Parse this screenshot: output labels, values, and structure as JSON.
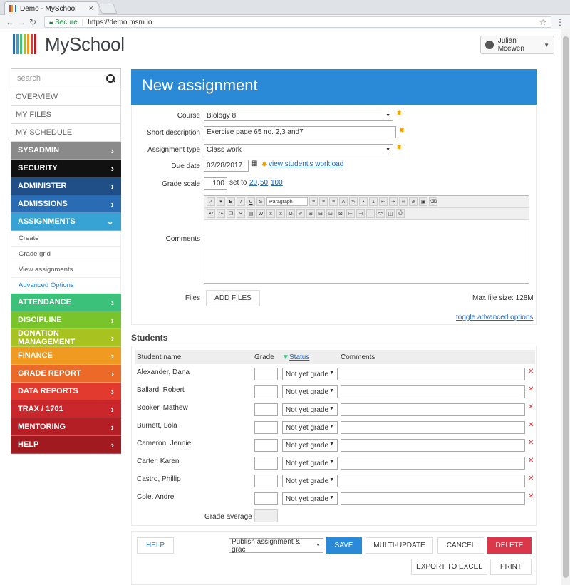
{
  "browser": {
    "tab_title": "Demo - MySchool",
    "tab_close": "×",
    "secure_label": "Secure",
    "url": "https://demo.msm.io"
  },
  "app": {
    "name": "MySchool",
    "user_name": "Julian Mcewen"
  },
  "sidebar": {
    "search_placeholder": "search",
    "plain_items": [
      "OVERVIEW",
      "MY FILES",
      "MY SCHEDULE"
    ],
    "nav": [
      {
        "label": "SYSADMIN",
        "color": "#8a8a8a"
      },
      {
        "label": "SECURITY",
        "color": "#111111"
      },
      {
        "label": "ADMINISTER",
        "color": "#1f4f86"
      },
      {
        "label": "ADMISSIONS",
        "color": "#2a6cb3"
      },
      {
        "label": "ASSIGNMENTS",
        "color": "#36a3d4"
      }
    ],
    "sub": [
      "Create",
      "Grade grid",
      "View assignments",
      "Advanced Options"
    ],
    "nav2": [
      {
        "label": "ATTENDANCE",
        "color": "#3cc17a"
      },
      {
        "label": "DISCIPLINE",
        "color": "#7ac42b"
      },
      {
        "label": "DONATION MANAGEMENT",
        "color": "#a8c21f"
      },
      {
        "label": "FINANCE",
        "color": "#f09a22"
      },
      {
        "label": "GRADE REPORT",
        "color": "#ec6a27"
      },
      {
        "label": "DATA REPORTS",
        "color": "#e23a2e"
      },
      {
        "label": "TRAX / 1701",
        "color": "#c9272c"
      },
      {
        "label": "MENTORING",
        "color": "#b31f24"
      },
      {
        "label": "HELP",
        "color": "#a01a1f"
      }
    ]
  },
  "form": {
    "title": "New assignment",
    "course_label": "Course",
    "course_value": "Biology 8",
    "desc_label": "Short description",
    "desc_value": "Exercise page 65 no. 2,3 and7",
    "type_label": "Assignment type",
    "type_value": "Class work",
    "due_label": "Due date",
    "due_value": "02/28/2017",
    "workload_link": "view student's workload",
    "scale_label": "Grade scale",
    "scale_value": "100",
    "set_to": "set to",
    "scale_opts": [
      "20",
      "50",
      "100"
    ],
    "comments_label": "Comments",
    "editor_format": "Paragraph",
    "files_label": "Files",
    "add_files": "ADD FILES",
    "max_file": "Max file size: 128M",
    "toggle_adv": "toggle advanced options"
  },
  "students": {
    "title": "Students",
    "col_name": "Student name",
    "col_grade": "Grade",
    "col_status": "Status",
    "col_comments": "Comments",
    "status_value": "Not yet grade",
    "rows": [
      "Alexander, Dana",
      "Ballard, Robert",
      "Booker, Mathew",
      "Burnett, Lola",
      "Cameron, Jennie",
      "Carter, Karen",
      "Castro, Phillip",
      "Cole, Andre"
    ],
    "grade_average": "Grade average"
  },
  "footer": {
    "help": "HELP",
    "publish": "Publish assignment & grac",
    "save": "SAVE",
    "multi": "MULTI-UPDATE",
    "cancel": "CANCEL",
    "delete": "DELETE",
    "export": "EXPORT TO EXCEL",
    "print": "PRINT"
  }
}
